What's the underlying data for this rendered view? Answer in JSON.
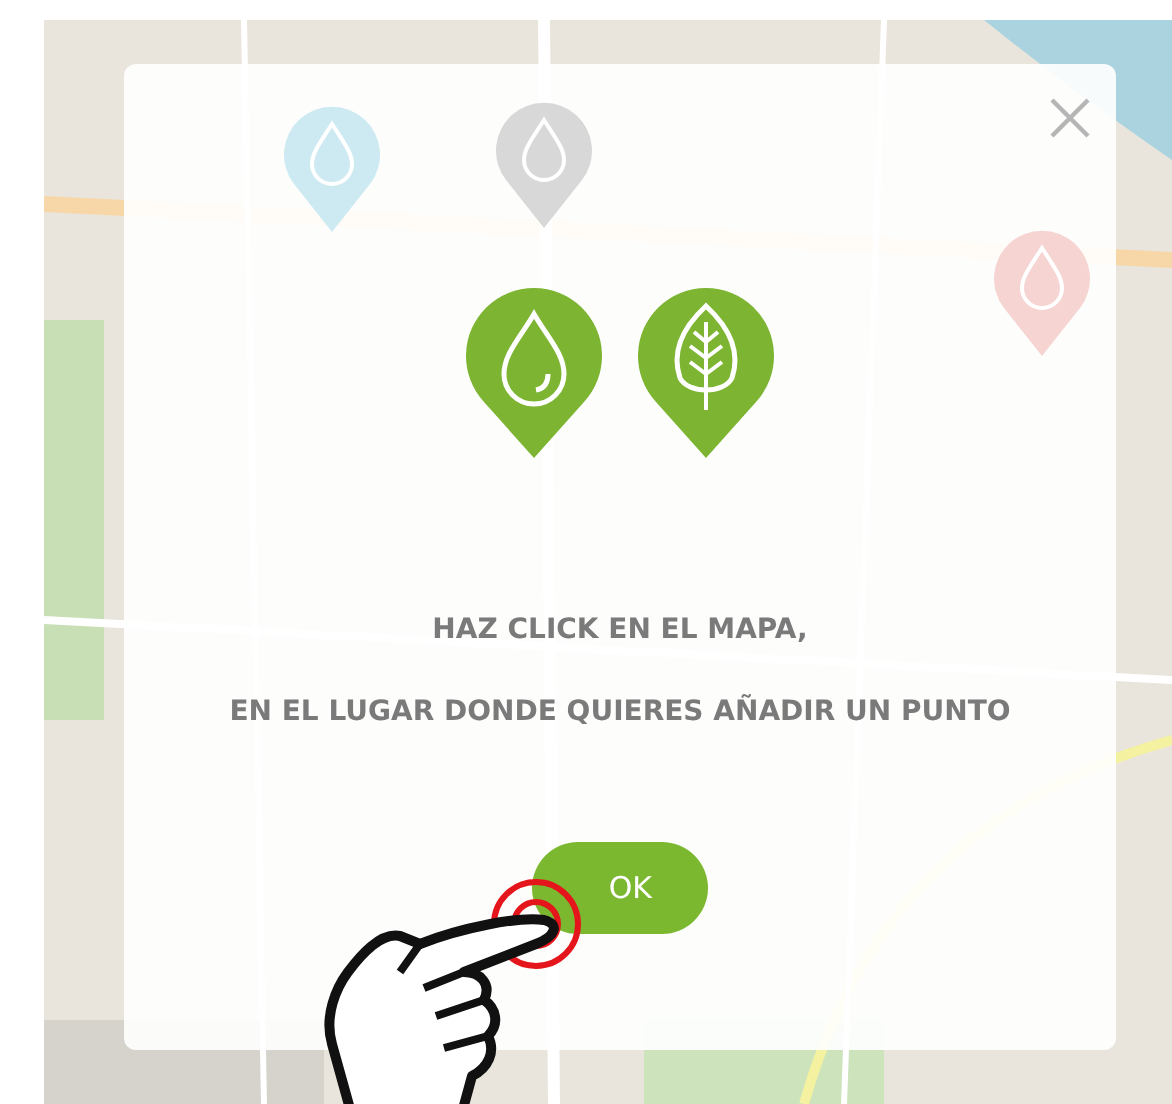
{
  "map_markers": [
    {
      "color": "#cdeaf3"
    },
    {
      "color": "#d8d8d8"
    },
    {
      "color": "#f6d4d2"
    }
  ],
  "dialog": {
    "message_lines": [
      "HAZ CLICK EN EL MAPA,",
      "EN EL LUGAR DONDE QUIERES AÑADIR UN PUNTO"
    ],
    "button": "OK"
  }
}
